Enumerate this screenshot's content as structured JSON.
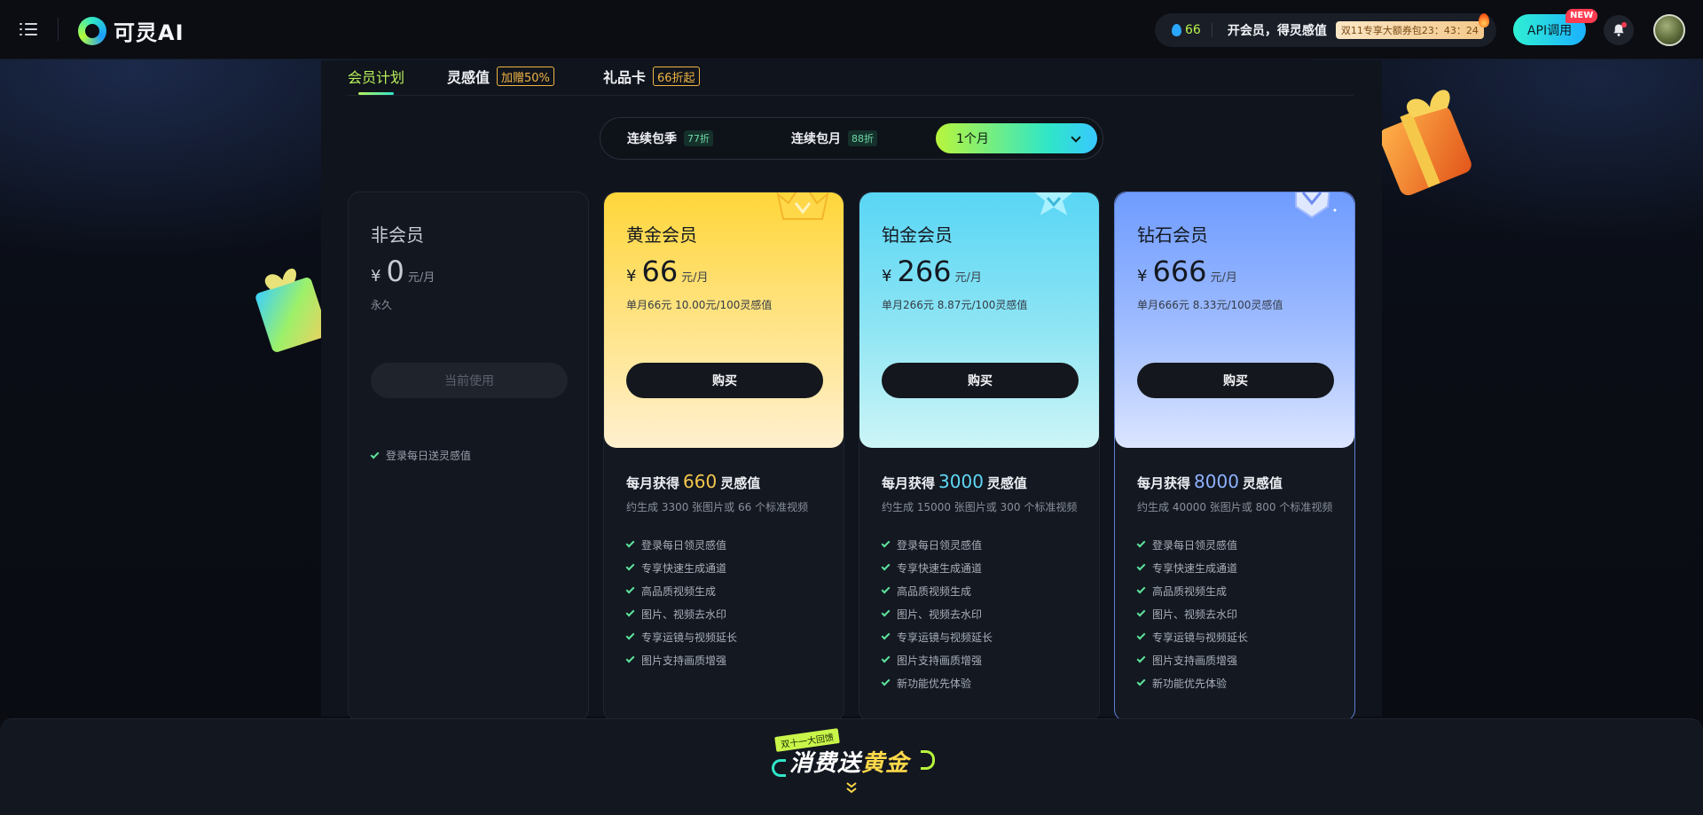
{
  "header": {
    "logo_text": "可灵AI",
    "points": "66",
    "vip_prompt": "开会员，得灵感值",
    "coupon_text": "双11专享大额券包23：43：24",
    "api_label": "API调用",
    "new_badge": "NEW"
  },
  "tabs": [
    {
      "label": "会员计划",
      "badge": ""
    },
    {
      "label": "灵感值",
      "badge": "加赠50%"
    },
    {
      "label": "礼品卡",
      "badge": "66折起"
    }
  ],
  "billing": {
    "options": [
      {
        "label": "连续包季",
        "tag": "77折"
      },
      {
        "label": "连续包月",
        "tag": "88折"
      }
    ],
    "selected": "1个月"
  },
  "plans": [
    {
      "name": "非会员",
      "currency": "¥",
      "price": "0",
      "unit": "元/月",
      "subnote": "永久",
      "button": "当前使用",
      "features": [
        "登录每日送灵感值"
      ]
    },
    {
      "name": "黄金会员",
      "currency": "¥",
      "price": "66",
      "unit": "元/月",
      "subnote": "单月66元 10.00元/100灵感值",
      "button": "购买",
      "monthly_prefix": "每月获得",
      "monthly_points": "660",
      "monthly_suffix": "灵感值",
      "gen_note": "约生成 3300 张图片或 66 个标准视频",
      "features": [
        "登录每日领灵感值",
        "专享快速生成通道",
        "高品质视频生成",
        "图片、视频去水印",
        "专享运镜与视频延长",
        "图片支持画质增强"
      ]
    },
    {
      "name": "铂金会员",
      "currency": "¥",
      "price": "266",
      "unit": "元/月",
      "subnote": "单月266元 8.87元/100灵感值",
      "button": "购买",
      "monthly_prefix": "每月获得",
      "monthly_points": "3000",
      "monthly_suffix": "灵感值",
      "gen_note": "约生成 15000 张图片或 300 个标准视频",
      "features": [
        "登录每日领灵感值",
        "专享快速生成通道",
        "高品质视频生成",
        "图片、视频去水印",
        "专享运镜与视频延长",
        "图片支持画质增强",
        "新功能优先体验"
      ]
    },
    {
      "name": "钻石会员",
      "currency": "¥",
      "price": "666",
      "unit": "元/月",
      "subnote": "单月666元 8.33元/100灵感值",
      "button": "购买",
      "monthly_prefix": "每月获得",
      "monthly_points": "8000",
      "monthly_suffix": "灵感值",
      "gen_note": "约生成 40000 张图片或 800 个标准视频",
      "features": [
        "登录每日领灵感值",
        "专享快速生成通道",
        "高品质视频生成",
        "图片、视频去水印",
        "专享运镜与视频延长",
        "图片支持画质增强",
        "新功能优先体验"
      ]
    }
  ],
  "promo": {
    "tag": "双十一大回馈",
    "title_white": "消费送",
    "title_gold": "黄金"
  },
  "colors": {
    "accent": "#b8f25a",
    "gold": "#ffd63a",
    "platinum": "#59d6f5",
    "diamond": "#6f9cff",
    "check": "#5ee39c"
  }
}
